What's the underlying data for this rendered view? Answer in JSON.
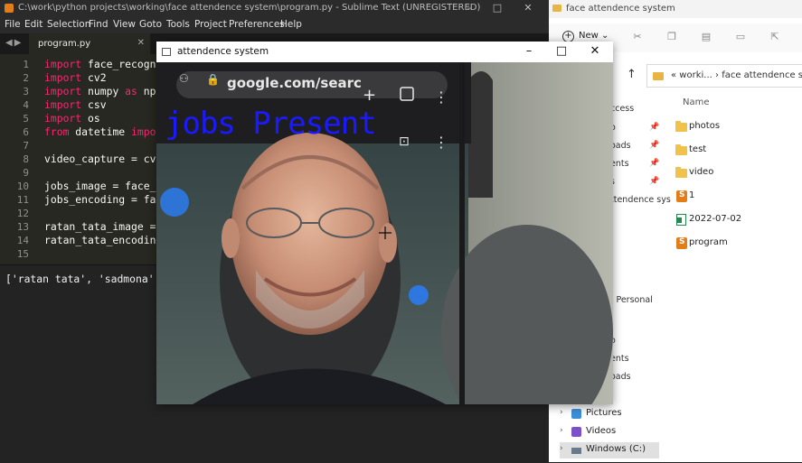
{
  "sublime": {
    "title": "C:\\work\\python projects\\working\\face attendence system\\program.py - Sublime Text (UNREGISTERED)",
    "menu": [
      "File",
      "Edit",
      "Selection",
      "Find",
      "View",
      "Goto",
      "Tools",
      "Project",
      "Preferences",
      "Help"
    ],
    "tab_label": "program.py",
    "line_numbers": [
      "1",
      "2",
      "3",
      "4",
      "5",
      "6",
      "7",
      "8",
      "9",
      "10",
      "11",
      "12",
      "13",
      "14",
      "15"
    ],
    "code": {
      "l1_kw": "import",
      "l1_rest": " face_recogn",
      "l2_kw": "import",
      "l2_rest": " cv2",
      "l3_kw": "import",
      "l3_rest": " numpy ",
      "l3_kw2": "as",
      "l3_rest2": " np",
      "l4_kw": "import",
      "l4_rest": " csv",
      "l5_kw": "import",
      "l5_rest": " os",
      "l6_kw": "from",
      "l6_rest": " datetime ",
      "l6_kw2": "impo",
      "l8": "video_capture = cv",
      "l10": "jobs_image = face_",
      "l11": "jobs_encoding = fa",
      "l13": "ratan_tata_image =",
      "l14": "ratan_tata_encodin"
    },
    "console_output": "['ratan tata', 'sadmona'"
  },
  "explorer": {
    "title": "face attendence system",
    "new_label": "New",
    "address_prefix": "« worki...",
    "address_sep": "›",
    "address_current": "face attendence system",
    "column_name": "Name",
    "files": [
      {
        "name": "photos",
        "type": "folder"
      },
      {
        "name": "test",
        "type": "folder"
      },
      {
        "name": "video",
        "type": "folder"
      },
      {
        "name": "1",
        "type": "sublime"
      },
      {
        "name": "2022-07-02",
        "type": "csv"
      },
      {
        "name": "program",
        "type": "sublime"
      }
    ],
    "nav_fragments": [
      "ccess",
      "o",
      "oads",
      "ents",
      "s",
      "ttendence sys",
      "- Personal",
      "o",
      "ents",
      "oads"
    ],
    "nav_items": [
      {
        "label": "Pictures",
        "icon": "pictures-icon"
      },
      {
        "label": "Videos",
        "icon": "videos-icon"
      },
      {
        "label": "Windows (C:)",
        "icon": "drive-icon"
      }
    ]
  },
  "camera_window": {
    "title": "attendence system",
    "overlay_label": "jobs Present",
    "phone_url": "google.com/searc"
  },
  "colors": {
    "sublime_bg": "#272822",
    "keyword": "#f92672",
    "overlay_text": "#1a1aff",
    "folder": "#f0c24b",
    "sublime_icon": "#e27d17"
  }
}
